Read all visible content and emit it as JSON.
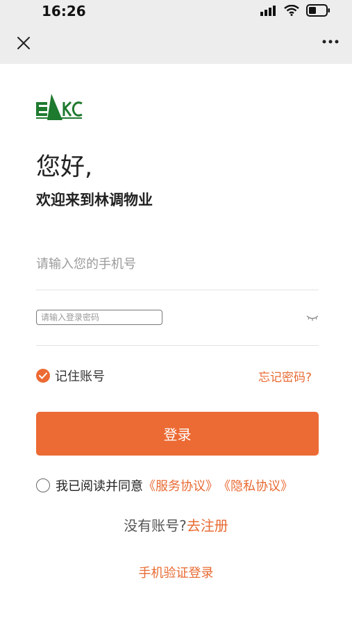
{
  "status_bar": {
    "time": "16:26",
    "icons": [
      "signal-icon",
      "wifi-icon",
      "battery-icon"
    ]
  },
  "nav": {
    "close_icon": "close-icon",
    "more_icon": "more-icon"
  },
  "brand": {
    "logo_text": "EKC"
  },
  "greeting": "您好,",
  "welcome": "欢迎来到林调物业",
  "phone_field": {
    "placeholder": "请输入您的手机号",
    "value": ""
  },
  "password_field": {
    "placeholder": "请输入登录密码",
    "value": "",
    "eye_icon": "eye-closed-icon"
  },
  "remember": {
    "label": "记住账号",
    "checked": true
  },
  "forgot_label": "忘记密码?",
  "login_label": "登录",
  "agreement": {
    "checked": false,
    "text": "我已阅读并同意",
    "service_link": "《服务协议》",
    "privacy_link": "《隐私协议》"
  },
  "register": {
    "prompt": "没有账号?",
    "link": "去注册"
  },
  "sms_login_label": "手机验证登录",
  "colors": {
    "accent": "#ec6a33",
    "logo_green": "#1e7a2e",
    "nav_bg": "#ededed"
  }
}
